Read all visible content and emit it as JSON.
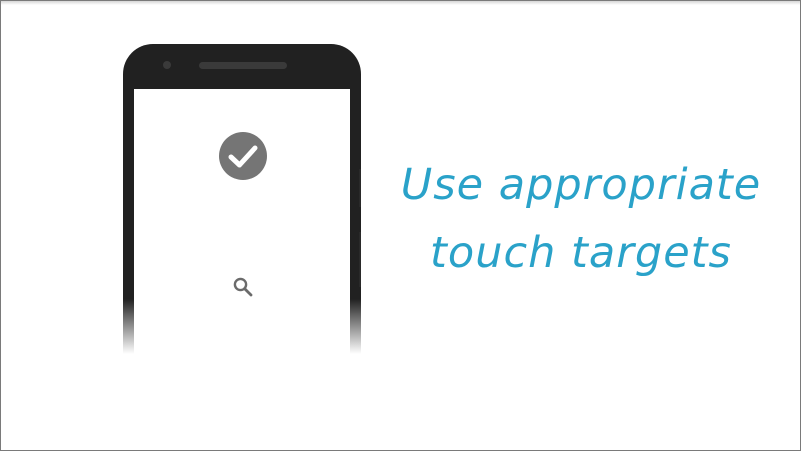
{
  "slide": {
    "caption_lines": [
      "Use appropriate",
      "touch targets"
    ]
  },
  "phone": {
    "icons": [
      "check-circle-icon",
      "search-icon"
    ]
  },
  "colors": {
    "caption": "#2aa2c9",
    "phone_body": "#212121",
    "icon_gray": "#757575",
    "background": "#ffffff"
  }
}
